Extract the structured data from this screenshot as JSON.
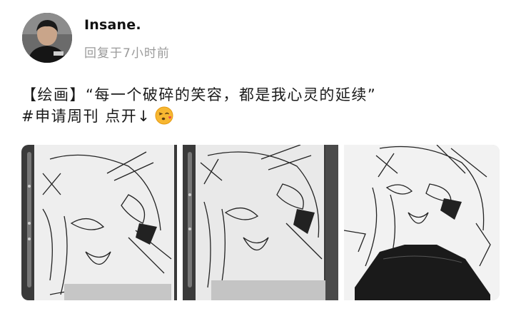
{
  "user": {
    "name": "Insane.",
    "meta": "回复于7小时前"
  },
  "post": {
    "line1": "【绘画】“每一个破碎的笑容，都是我心灵的延续”",
    "line2": "#申请周刊  点开↓",
    "emoji": "kissing-face-emoji"
  },
  "gallery": {
    "images": [
      {
        "name": "sketch-photo-1"
      },
      {
        "name": "sketch-photo-2"
      },
      {
        "name": "sketch-photo-3"
      }
    ]
  },
  "colors": {
    "username": "#111111",
    "meta": "#9a9a9a",
    "caption": "#1a1a1a"
  }
}
